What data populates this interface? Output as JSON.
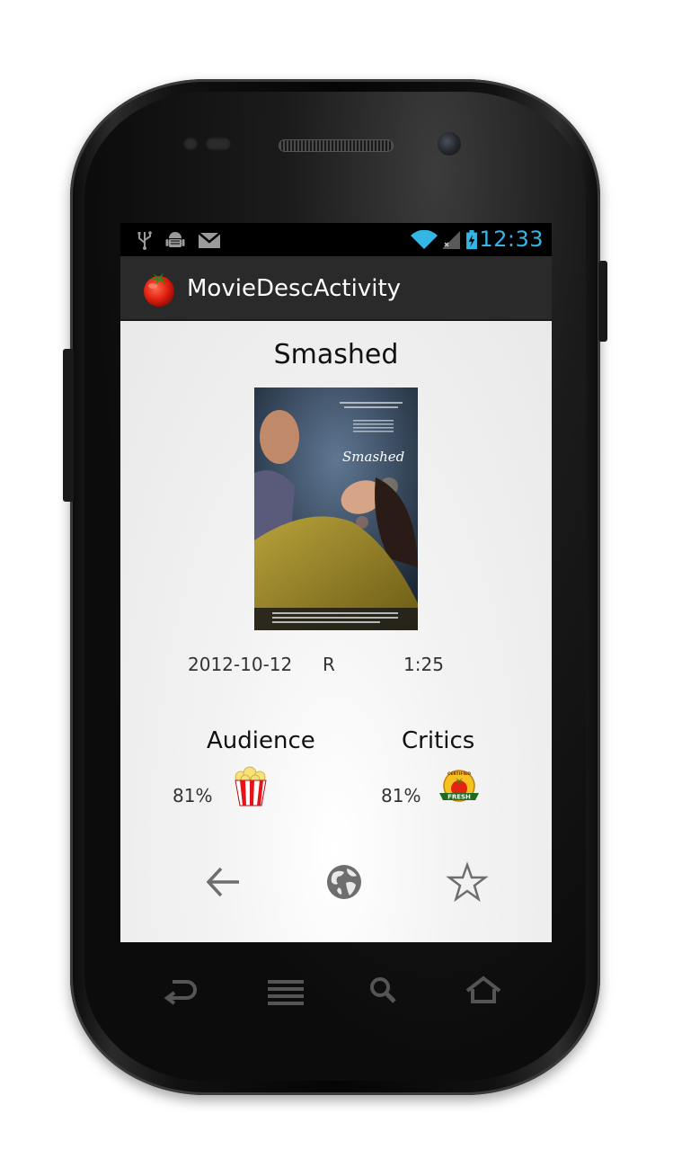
{
  "status_bar": {
    "time": "12:33",
    "left_icons": [
      "usb-icon",
      "android-debug-icon",
      "gmail-icon"
    ],
    "right_icons": [
      "wifi-icon",
      "signal-no-service-icon",
      "battery-charging-icon"
    ],
    "accent_color": "#33b5e5"
  },
  "action_bar": {
    "title": "MovieDescActivity",
    "icon": "tomato-icon"
  },
  "movie": {
    "title": "Smashed",
    "release_date": "2012-10-12",
    "mpaa_rating": "R",
    "runtime": "1:25",
    "poster": {
      "tagline": "\"A TOUR-DE-FORCE PERFORMANCE BY MARY ELIZABETH WINSTEAD.\"",
      "title_script": "Smashed"
    }
  },
  "scores": {
    "audience": {
      "label": "Audience",
      "percent": "81%",
      "icon": "popcorn-icon"
    },
    "critics": {
      "label": "Critics",
      "percent": "81%",
      "icon": "certified-fresh-icon",
      "badge_top": "CERTIFIED",
      "badge_bottom": "FRESH"
    }
  },
  "bottom_actions": [
    "back-arrow-icon",
    "globe-icon",
    "star-icon"
  ],
  "hardware_keys": [
    "back-key-icon",
    "menu-key-icon",
    "search-key-icon",
    "home-key-icon"
  ]
}
